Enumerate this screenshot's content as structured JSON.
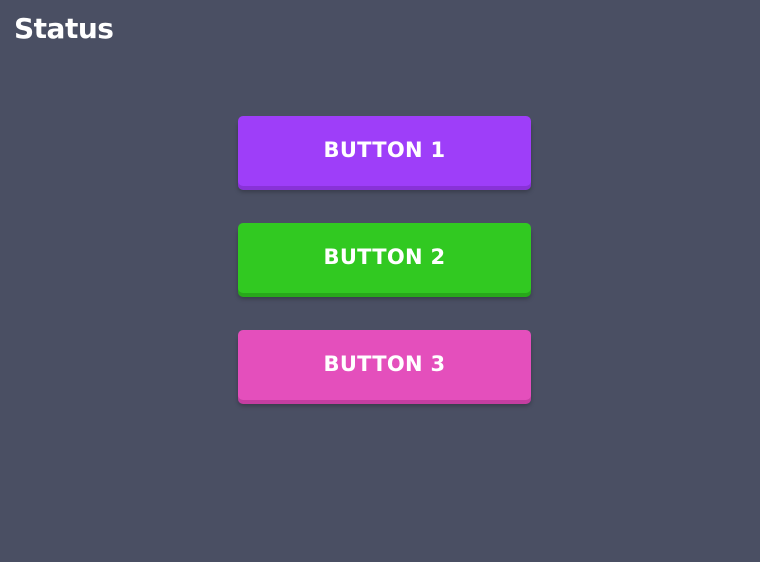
{
  "header": {
    "title": "Status"
  },
  "buttons": [
    {
      "label": "BUTTON 1",
      "color": "#9e3ef9"
    },
    {
      "label": "BUTTON 2",
      "color": "#31c921"
    },
    {
      "label": "BUTTON 3",
      "color": "#e44fbc"
    }
  ],
  "theme": {
    "background": "#4a4f63",
    "text": "#ffffff"
  }
}
